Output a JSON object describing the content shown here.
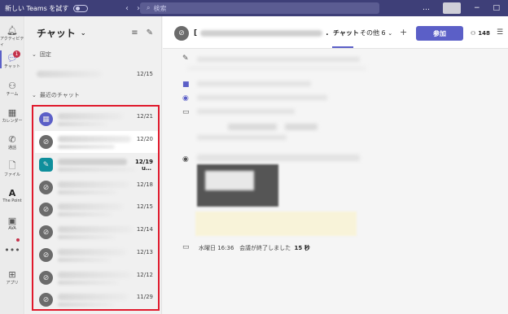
{
  "titlebar": {
    "new_teams_label": "新しい Teams を試す",
    "search_placeholder": "検索",
    "back_icon": "chevron-left-icon",
    "forward_icon": "chevron-right-icon",
    "more_label": "…",
    "minimize": "−",
    "maximize": "□"
  },
  "rail": {
    "items": [
      {
        "label": "アクティビティ",
        "icon": "bell-icon"
      },
      {
        "label": "チャット",
        "icon": "chat-icon",
        "badge": "1"
      },
      {
        "label": "チーム",
        "icon": "teams-icon"
      },
      {
        "label": "カレンダー",
        "icon": "calendar-icon"
      },
      {
        "label": "通話",
        "icon": "phone-icon"
      },
      {
        "label": "ファイル",
        "icon": "file-icon"
      },
      {
        "label": "The Point",
        "icon": "thepoint-icon"
      },
      {
        "label": "AVA",
        "icon": "ava-icon"
      },
      {
        "label": "•••",
        "icon": "more-icon"
      },
      {
        "label": "アプリ",
        "icon": "apps-icon"
      }
    ]
  },
  "chatlist": {
    "title": "チャット",
    "pinned_label": "固定",
    "recent_label": "最近のチャット",
    "pinned": [
      {
        "date": "12/15"
      }
    ],
    "recent": [
      {
        "date": "12/21",
        "avatar": "calendar"
      },
      {
        "date": "12/20",
        "avatar": "group"
      },
      {
        "date": "12/19",
        "avatar": "teal",
        "bold": true,
        "suffix": "u…"
      },
      {
        "date": "12/18",
        "avatar": "group"
      },
      {
        "date": "12/15",
        "avatar": "group"
      },
      {
        "date": "12/14",
        "avatar": "group"
      },
      {
        "date": "12/13",
        "avatar": "group"
      },
      {
        "date": "12/12",
        "avatar": "group"
      },
      {
        "date": "11/29",
        "avatar": "group"
      }
    ]
  },
  "conversation": {
    "title_prefix": "[",
    "title_suffix": ".",
    "tab_chat": "チャット",
    "tab_more": "その他 6",
    "join_label": "参加",
    "participants": "148",
    "ended_day": "水曜日 16:36",
    "ended_text": "会議が終了しました",
    "ended_duration": "15 秒"
  },
  "colors": {
    "accent": "#5b5fc7",
    "titlebar": "#3e3f78",
    "highlight_box": "#e0192c"
  }
}
